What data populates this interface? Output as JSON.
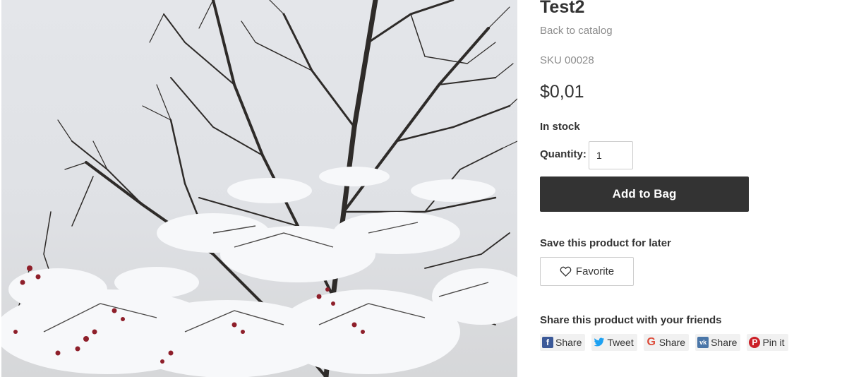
{
  "product": {
    "title": "Test2",
    "back_link": "Back to catalog",
    "sku": "SKU 00028",
    "price": "$0,01",
    "stock_status": "In stock",
    "quantity_label": "Quantity:",
    "quantity_value": "1",
    "add_to_bag_label": "Add to Bag",
    "image_alt": "Snow covered tree branches"
  },
  "favorite": {
    "section_label": "Save this product for later",
    "button_label": "Favorite",
    "icon": "heart-outline-icon"
  },
  "share": {
    "section_label": "Share this product with your friends",
    "buttons": [
      {
        "label": "Share",
        "icon": "facebook-icon",
        "color": "#3b5998"
      },
      {
        "label": "Tweet",
        "icon": "twitter-icon",
        "color": "#1da1f2"
      },
      {
        "label": "Share",
        "icon": "google-icon",
        "color": "#dd4b39"
      },
      {
        "label": "Share",
        "icon": "vk-icon",
        "color": "#4a76a8"
      },
      {
        "label": "Pin it",
        "icon": "pinterest-icon",
        "color": "#cb2027"
      }
    ]
  },
  "colors": {
    "button_dark": "#333333",
    "muted_text": "#8c8c8c"
  }
}
